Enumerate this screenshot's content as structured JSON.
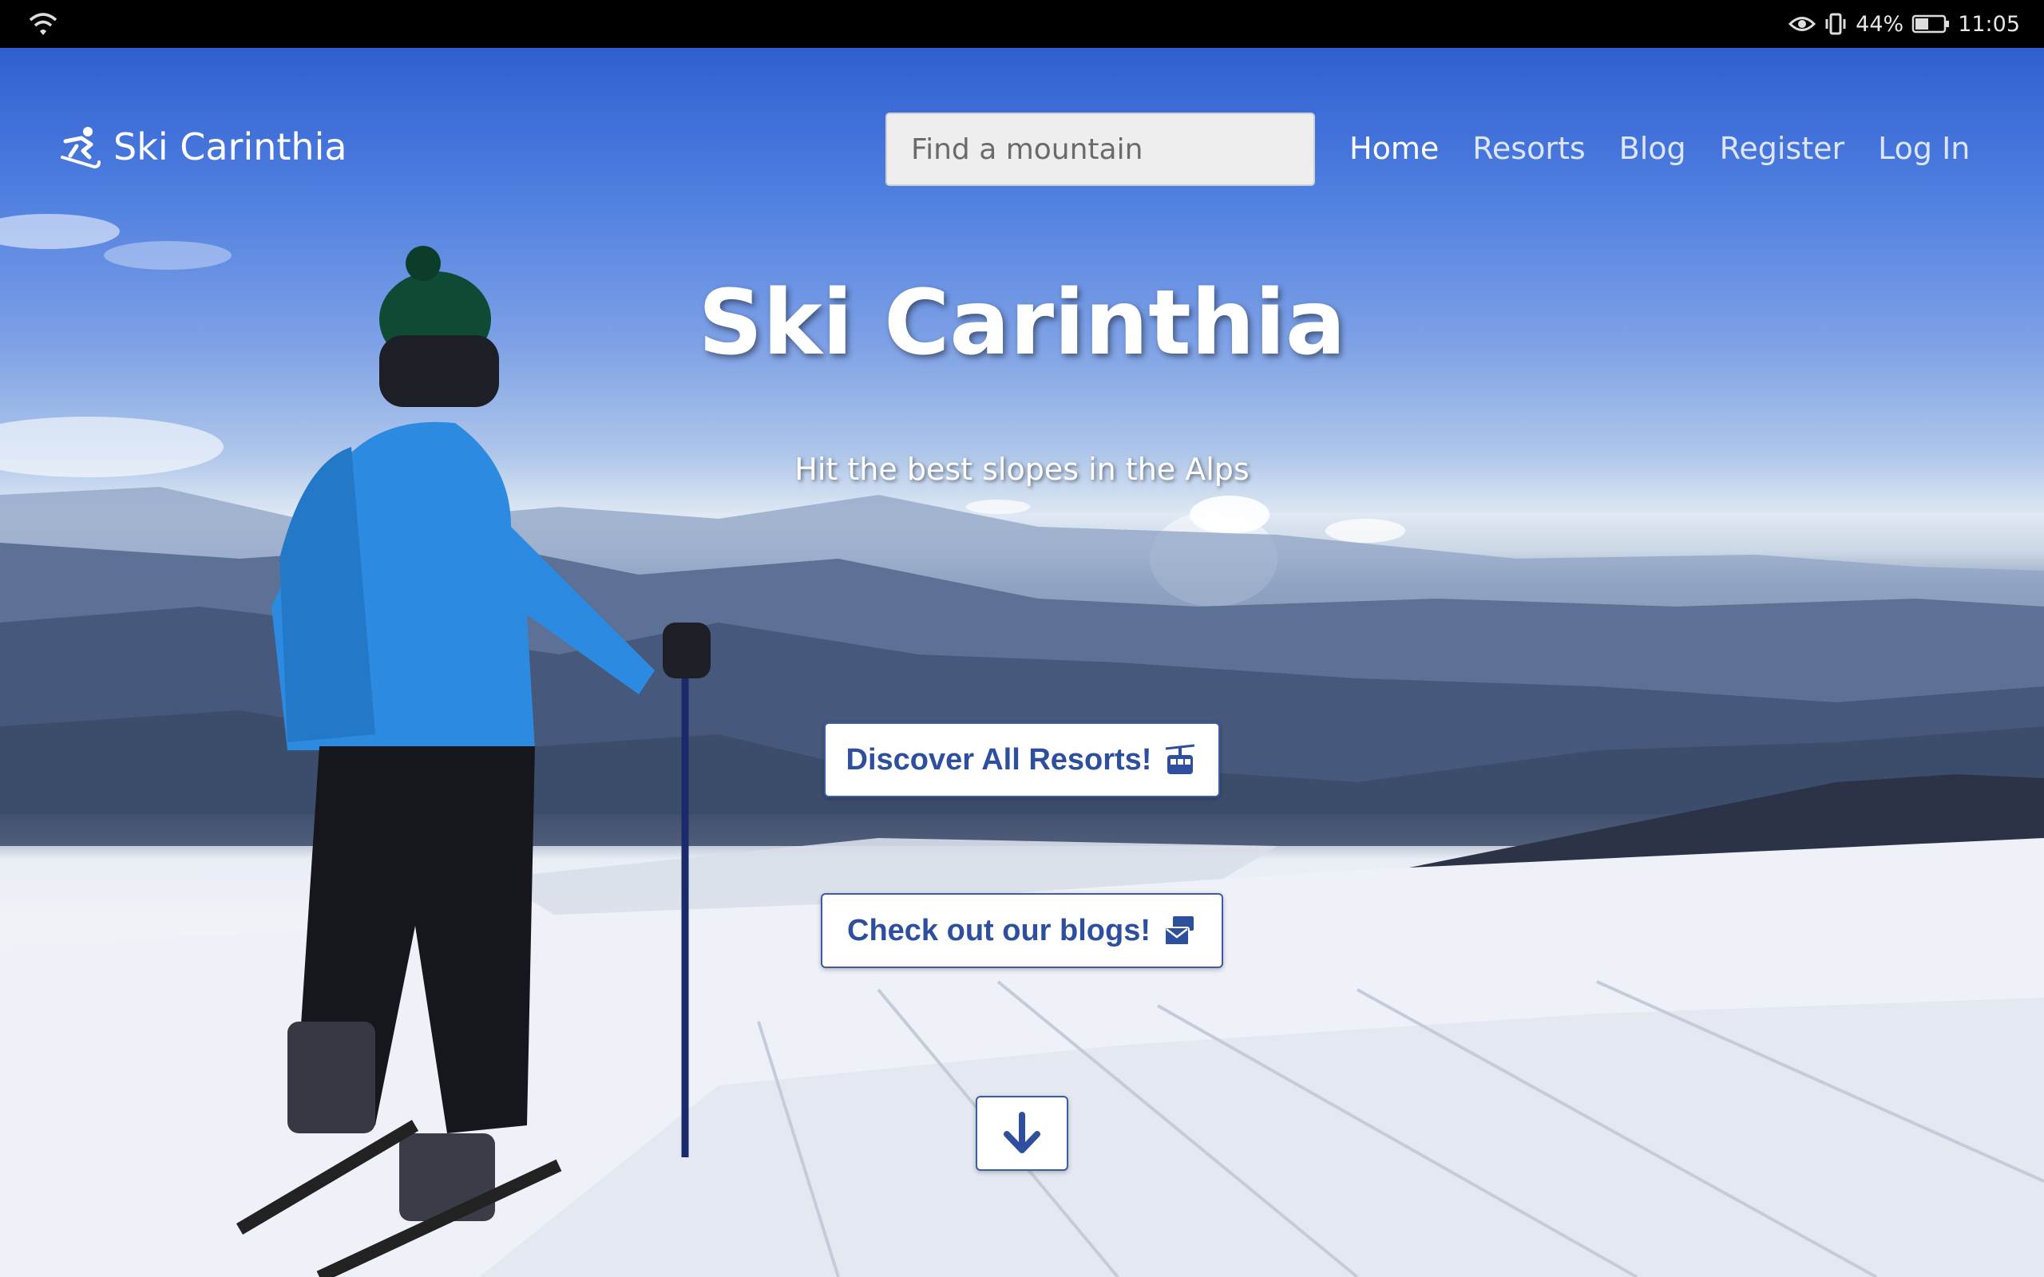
{
  "status_bar": {
    "battery": "44%",
    "time": "11:05",
    "icons": [
      "wifi-icon",
      "eye-icon",
      "vibrate-icon",
      "battery-icon"
    ]
  },
  "navbar": {
    "brand": "Ski Carinthia",
    "brand_icon": "skier-icon",
    "search_placeholder": "Find a mountain",
    "links": [
      "Home",
      "Resorts",
      "Blog",
      "Register",
      "Log In"
    ],
    "active_link": "Home"
  },
  "hero": {
    "title": "Ski Carinthia",
    "subtitle": "Hit the best slopes in the Alps",
    "buttons": {
      "resorts": "Discover All Resorts!",
      "resorts_icon": "cable-car-icon",
      "blogs": "Check out our blogs!",
      "blogs_icon": "mail-bulk-icon",
      "scroll_icon": "arrow-down-icon"
    }
  },
  "colors": {
    "accent": "#2e4f9e",
    "status_bar": "#000000",
    "text_light": "#ffffff"
  }
}
